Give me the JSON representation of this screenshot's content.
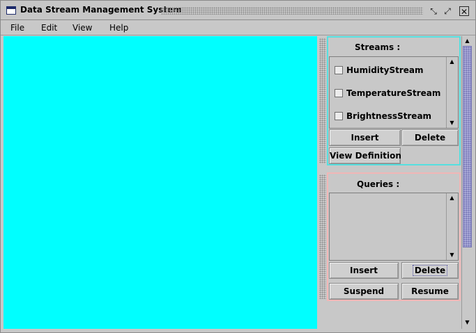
{
  "window": {
    "title": "Data Stream Management System",
    "icons": {
      "app": "window-icon",
      "minimize": "restore-icon",
      "maximize": "maximize-icon",
      "close": "close-icon"
    }
  },
  "menu": {
    "items": [
      "File",
      "Edit",
      "View",
      "Help"
    ]
  },
  "colors": {
    "canvas": "#00ffff",
    "streams_border": "#55e0e0",
    "queries_border": "#f2b6b6",
    "scroll_thumb": "#a9a9d8"
  },
  "streams": {
    "title": "Streams :",
    "items": [
      {
        "label": "HumidityStream",
        "checked": false
      },
      {
        "label": "TemperatureStream",
        "checked": false
      },
      {
        "label": "BrightnessStream",
        "checked": false
      }
    ],
    "buttons": {
      "insert": "Insert",
      "delete": "Delete",
      "view_definition": "View Definition"
    }
  },
  "queries": {
    "title": "Queries :",
    "items": [],
    "buttons": {
      "insert": "Insert",
      "delete": "Delete",
      "suspend": "Suspend",
      "resume": "Resume"
    }
  }
}
